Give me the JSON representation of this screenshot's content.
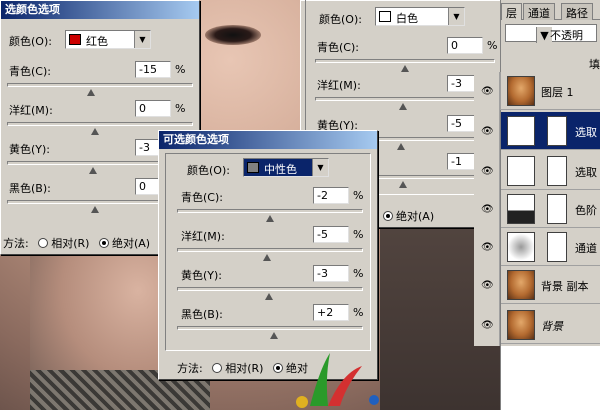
{
  "dialog1": {
    "title": "选颜色选项",
    "color_label": "颜色(O):",
    "color_value": "红色",
    "swatch": "#cc0000",
    "sliders": [
      {
        "label": "青色(C):",
        "value": "-15",
        "unit": "%"
      },
      {
        "label": "洋红(M):",
        "value": "0",
        "unit": "%"
      },
      {
        "label": "黄色(Y):",
        "value": "-3",
        "unit": "%"
      },
      {
        "label": "黑色(B):",
        "value": "0",
        "unit": "%"
      }
    ],
    "method_label": "方法:",
    "method_relative": "相对(R)",
    "method_absolute": "绝对(A)"
  },
  "dialog2": {
    "color_label": "颜色(O):",
    "color_value": "白色",
    "swatch": "#ffffff",
    "sliders": [
      {
        "label": "青色(C):",
        "value": "0",
        "unit": "%"
      },
      {
        "label": "洋红(M):",
        "value": "-3",
        "unit": "%"
      },
      {
        "label": "黄色(Y):",
        "value": "-5",
        "unit": "%"
      },
      {
        "label": "",
        "value": "-1",
        "unit": "%"
      }
    ],
    "method_absolute": "绝对(A)"
  },
  "dialog3": {
    "title": "可选颜色选项",
    "color_label": "颜色(O):",
    "color_value": "中性色",
    "swatch": "#808080",
    "sliders": [
      {
        "label": "青色(C):",
        "value": "-2",
        "unit": "%"
      },
      {
        "label": "洋红(M):",
        "value": "-5",
        "unit": "%"
      },
      {
        "label": "黄色(Y):",
        "value": "-3",
        "unit": "%"
      },
      {
        "label": "黑色(B):",
        "value": "+2",
        "unit": "%"
      }
    ],
    "method_label": "方法:",
    "method_relative": "相对(R)",
    "method_absolute": "绝对"
  },
  "layers_panel": {
    "tabs": [
      "层",
      "通道",
      "路径"
    ],
    "blend_mode": "不透明",
    "side_label": "填",
    "layers": [
      {
        "name": "图层 1",
        "type": "image"
      },
      {
        "name": "选取",
        "type": "adjustment",
        "active": true
      },
      {
        "name": "选取",
        "type": "adjustment"
      },
      {
        "name": "色阶",
        "type": "levels"
      },
      {
        "name": "通道",
        "type": "channel"
      },
      {
        "name": "背景 副本",
        "type": "image"
      },
      {
        "name": "背景",
        "type": "image",
        "italic": true
      }
    ]
  }
}
